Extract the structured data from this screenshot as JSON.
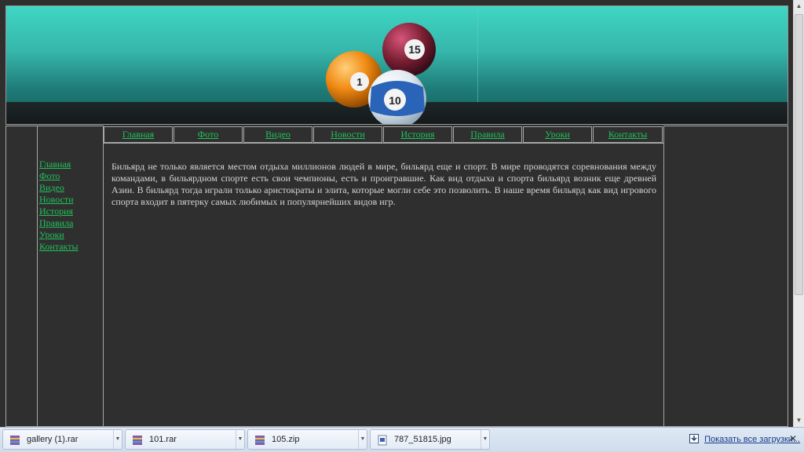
{
  "nav": {
    "top": [
      "Главная",
      "Фото",
      "Видео",
      "Новости",
      "История",
      "Правила",
      "Уроки",
      "Контакты"
    ],
    "side": [
      "Главная",
      "Фото",
      "Видео",
      "Новости",
      "История",
      "Правила",
      "Уроки",
      "Контакты"
    ]
  },
  "content": {
    "text": "Бильярд не только является местом отдыха миллионов людей в мире, бильярд еще и спорт. В мире проводятся соревнования между командами, в бильярдном спорте есть свои чемпионы, есть и проигравшие. Как вид отдыха и спорта бильярд возник еще древней Азии. В бильярд тогда играли только аристократы и элита, которые могли себе это позволить. В наше время бильярд как вид игрового спорта входит в пятерку самых любимых и популярнейших видов игр."
  },
  "banner": {
    "balls": [
      "15",
      "1",
      "10"
    ]
  },
  "downloads": {
    "items": [
      {
        "name": "gallery (1).rar",
        "icon": "archive-icon"
      },
      {
        "name": "101.rar",
        "icon": "archive-icon"
      },
      {
        "name": "105.zip",
        "icon": "archive-icon"
      },
      {
        "name": "787_51815.jpg",
        "icon": "image-file-icon"
      }
    ],
    "show_all": "Показать все загрузки..."
  },
  "colors": {
    "link": "#1fc35a",
    "background": "#2f2f2f",
    "text": "#d6d6d6"
  }
}
